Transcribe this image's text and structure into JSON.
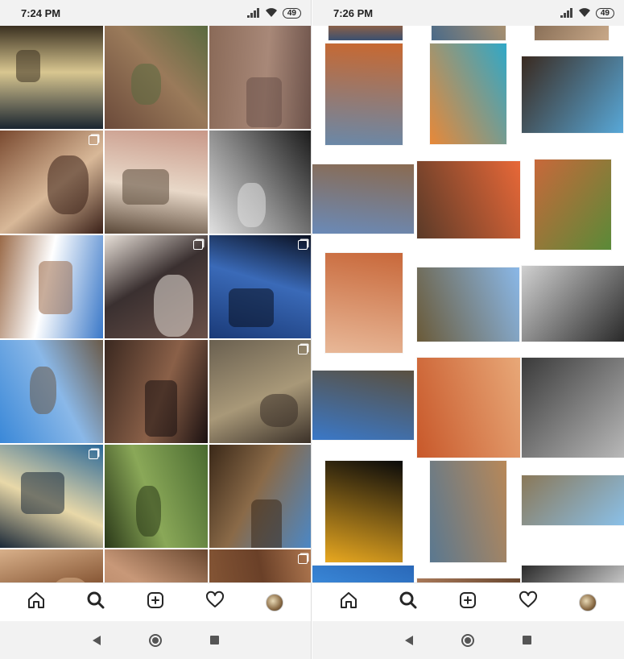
{
  "left": {
    "status": {
      "time": "7:24 PM",
      "battery": "49"
    },
    "tiles": [
      {
        "name": "tile-hand-fruit",
        "colors": [
          "#1a2530",
          "#d8c690",
          "#3a3020"
        ],
        "multi": false
      },
      {
        "name": "tile-desert-cactus",
        "colors": [
          "#6b4a3a",
          "#9a7a5a",
          "#5a6a40"
        ],
        "multi": false
      },
      {
        "name": "tile-rock-texture",
        "colors": [
          "#8a6a58",
          "#a88878",
          "#6a5048"
        ],
        "multi": false
      },
      {
        "name": "tile-cave-paintings",
        "colors": [
          "#7a4a30",
          "#d8b898",
          "#3a2018"
        ],
        "multi": true
      },
      {
        "name": "tile-people-portrait",
        "colors": [
          "#c89888",
          "#e8d8c8",
          "#5a4838"
        ],
        "multi": false
      },
      {
        "name": "tile-cowboy-bw",
        "colors": [
          "#1a1a1a",
          "#8a8a8a",
          "#e0e0e0"
        ],
        "multi": false
      },
      {
        "name": "tile-blue-sky-road",
        "colors": [
          "#3a78c8",
          "#ffffff",
          "#9a6a48"
        ],
        "multi": false
      },
      {
        "name": "tile-woman-rock",
        "colors": [
          "#6a5048",
          "#3a3030",
          "#e8e0d8"
        ],
        "multi": true
      },
      {
        "name": "tile-silhouette-rock",
        "colors": [
          "#1a3a78",
          "#3a6ab8",
          "#0a1020"
        ],
        "multi": true
      },
      {
        "name": "tile-rider-blue-sky",
        "colors": [
          "#3a88d8",
          "#8ab8e8",
          "#6a5a48"
        ],
        "multi": false
      },
      {
        "name": "tile-cave-wall",
        "colors": [
          "#3a2820",
          "#8a6048",
          "#1a1010"
        ],
        "multi": false
      },
      {
        "name": "tile-mule-trail",
        "colors": [
          "#6a6050",
          "#a89878",
          "#3a3028"
        ],
        "multi": true
      },
      {
        "name": "tile-mission-church",
        "colors": [
          "#2a6898",
          "#e8d8a8",
          "#1a2838"
        ],
        "multi": true
      },
      {
        "name": "tile-woman-palm",
        "colors": [
          "#4a6a30",
          "#8aa858",
          "#2a3818"
        ],
        "multi": false
      },
      {
        "name": "tile-canyon-riders",
        "colors": [
          "#4a88c8",
          "#8a6a48",
          "#3a2818"
        ],
        "multi": false
      },
      {
        "name": "tile-rock-orange",
        "colors": [
          "#b8886a",
          "#8a5a38",
          "#d8b08a"
        ],
        "multi": false
      },
      {
        "name": "tile-rock-petro",
        "colors": [
          "#a87858",
          "#c89878",
          "#6a4830"
        ],
        "multi": false
      },
      {
        "name": "tile-rock-brown",
        "colors": [
          "#8a5a38",
          "#6a4028",
          "#b07850"
        ],
        "multi": true
      }
    ]
  },
  "right": {
    "status": {
      "time": "7:26 PM",
      "battery": "49"
    },
    "photos": [
      {
        "name": "photo-top-1",
        "colors": [
          "#3a5070",
          "#8a6048"
        ]
      },
      {
        "name": "photo-top-2",
        "colors": [
          "#4a6a88",
          "#a89070"
        ]
      },
      {
        "name": "photo-top-3",
        "colors": [
          "#8a7058",
          "#c8a888"
        ]
      },
      {
        "name": "photo-canyon-pool",
        "colors": [
          "#c86830",
          "#6a88a8"
        ]
      },
      {
        "name": "photo-soup-bowl",
        "colors": [
          "#30a8c8",
          "#e88838"
        ]
      },
      {
        "name": "photo-cave-overlook",
        "colors": [
          "#58a8d8",
          "#3a2a20"
        ]
      },
      {
        "name": "photo-rock-sky",
        "colors": [
          "#6a8ab8",
          "#8a6a50"
        ]
      },
      {
        "name": "photo-boots-cigar",
        "colors": [
          "#5a3a28",
          "#e86838"
        ]
      },
      {
        "name": "photo-canyon-stream",
        "colors": [
          "#c8683a",
          "#5a8a38"
        ]
      },
      {
        "name": "photo-deer-painting",
        "colors": [
          "#c8683a",
          "#e8b898"
        ]
      },
      {
        "name": "photo-cactus-canyon",
        "colors": [
          "#8ab8e8",
          "#6a5a38"
        ]
      },
      {
        "name": "photo-mule-bw",
        "colors": [
          "#2a2a2a",
          "#d0d0d0"
        ]
      },
      {
        "name": "photo-mesa-vista",
        "colors": [
          "#3a78c8",
          "#5a5040"
        ]
      },
      {
        "name": "photo-red-figures",
        "colors": [
          "#c8582a",
          "#e8a878"
        ]
      },
      {
        "name": "photo-cardon-bw",
        "colors": [
          "#3a3a3a",
          "#b8b8b8"
        ]
      },
      {
        "name": "photo-waterfall-dark",
        "colors": [
          "#0a0a0a",
          "#e8a820"
        ]
      },
      {
        "name": "photo-rock-formation",
        "colors": [
          "#b88858",
          "#5a7890"
        ]
      },
      {
        "name": "photo-road-cattle",
        "colors": [
          "#8ac0e8",
          "#8a7858"
        ]
      },
      {
        "name": "photo-bottom-blue",
        "colors": [
          "#3a88d8",
          "#2a68b8"
        ]
      },
      {
        "name": "photo-bottom-brown",
        "colors": [
          "#a87858",
          "#6a4830"
        ]
      },
      {
        "name": "photo-bottom-dark",
        "colors": [
          "#2a2a2a",
          "#c8c8c8"
        ]
      }
    ]
  },
  "nav": {
    "items": [
      {
        "name": "home",
        "icon": "home-icon"
      },
      {
        "name": "search",
        "icon": "search-icon"
      },
      {
        "name": "new-post",
        "icon": "add-post-icon"
      },
      {
        "name": "activity",
        "icon": "heart-icon"
      },
      {
        "name": "profile",
        "icon": "profile-avatar"
      }
    ]
  }
}
